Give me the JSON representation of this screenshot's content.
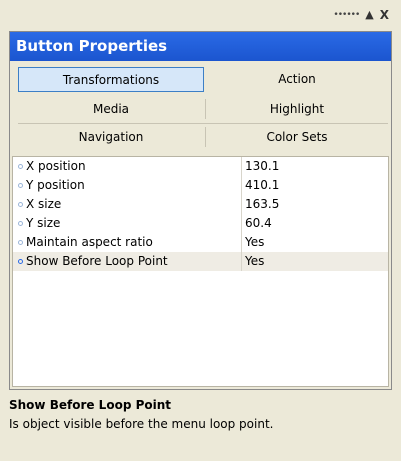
{
  "window": {
    "controls": {
      "grip": "••••••",
      "pin": "▲",
      "close": "X"
    }
  },
  "panel": {
    "title": "Button Properties",
    "tabs": [
      {
        "label": "Transformations",
        "active": true
      },
      {
        "label": "Action",
        "active": false
      },
      {
        "label": "Media",
        "active": false
      },
      {
        "label": "Highlight",
        "active": false
      },
      {
        "label": "Navigation",
        "active": false
      },
      {
        "label": "Color Sets",
        "active": false
      }
    ],
    "properties": [
      {
        "name": "X position",
        "value": "130.1"
      },
      {
        "name": "Y position",
        "value": "410.1"
      },
      {
        "name": "X size",
        "value": "163.5"
      },
      {
        "name": "Y size",
        "value": "60.4"
      },
      {
        "name": "Maintain aspect ratio",
        "value": "Yes"
      },
      {
        "name": "Show Before Loop Point",
        "value": "Yes",
        "selected": true
      }
    ]
  },
  "description": {
    "title": "Show Before Loop Point",
    "text": "Is object visible before the menu loop point."
  },
  "colors": {
    "title_bar": "#1f5fd8",
    "active_tab": "#d6e7f9",
    "background": "#ece9d8"
  }
}
